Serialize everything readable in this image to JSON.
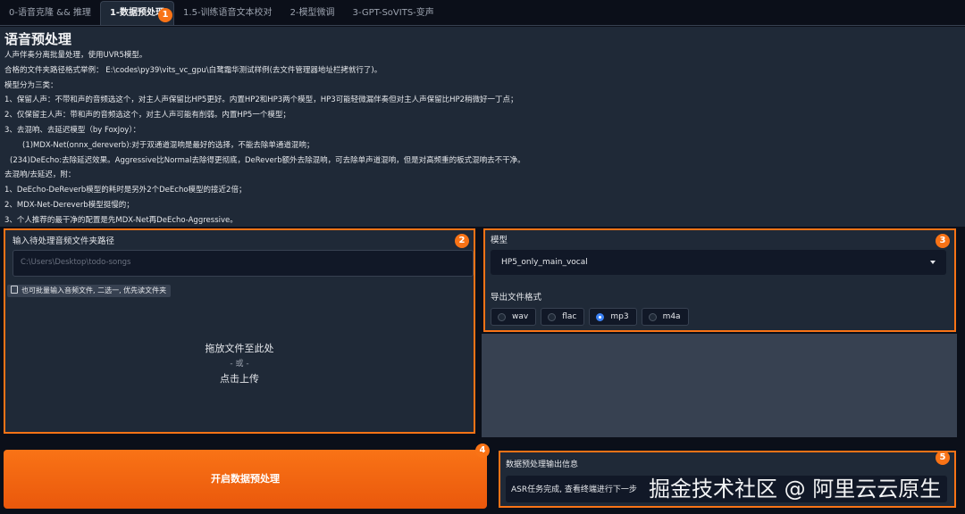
{
  "tabs": [
    {
      "label": "0-语音克隆 && 推理"
    },
    {
      "label": "1-数据预处理"
    },
    {
      "label": "1.5-训练语音文本校对"
    },
    {
      "label": "2-模型微调"
    },
    {
      "label": "3-GPT-SoVITS-变声"
    }
  ],
  "badges": [
    "1",
    "2",
    "3",
    "4",
    "5"
  ],
  "intro": {
    "title": "语音预处理",
    "lines": [
      "人声伴奏分离批量处理，使用UVR5模型。",
      "合格的文件夹路径格式举例： E:\\codes\\py39\\vits_vc_gpu\\白鹭霜华测试样例(去文件管理器地址栏拷就行了)。",
      "模型分为三类：",
      "1、保留人声：不带和声的音频选这个，对主人声保留比HP5更好。内置HP2和HP3两个模型，HP3可能轻微漏伴奏但对主人声保留比HP2稍微好一丁点；",
      "2、仅保留主人声：带和声的音频选这个，对主人声可能有削弱。内置HP5一个模型；",
      "3、去混响、去延迟模型（by FoxJoy）：",
      "(1)MDX-Net(onnx_dereverb):对于双通道混响是最好的选择，不能去除单通道混响；",
      "(234)DeEcho:去除延迟效果。Aggressive比Normal去除得更彻底，DeReverb额外去除混响，可去除单声道混响，但是对高频重的板式混响去不干净。",
      "去混响/去延迟，附：",
      "1、DeEcho-DeReverb模型的耗时是另外2个DeEcho模型的接近2倍；",
      "2、MDX-Net-Dereverb模型挺慢的；",
      "3、个人推荐的最干净的配置是先MDX-Net再DeEcho-Aggressive。"
    ]
  },
  "left_panel": {
    "label": "输入待处理音频文件夹路径",
    "placeholder": "C:\\Users\\Desktop\\todo-songs",
    "hint": "也可批量输入音频文件, 二选一, 优先读文件夹",
    "drop_text": "拖放文件至此处",
    "or_text": "- 或 -",
    "upload_text": "点击上传"
  },
  "right_panel": {
    "model_label": "模型",
    "model_value": "HP5_only_main_vocal",
    "format_label": "导出文件格式",
    "formats": [
      "wav",
      "flac",
      "mp3",
      "m4a"
    ],
    "selected_format": "mp3"
  },
  "start_button": "开启数据预处理",
  "output": {
    "label": "数据预处理输出信息",
    "value": "ASR任务完成, 查看终端进行下一步"
  },
  "watermark": "掘金技术社区 @ 阿里云云原生"
}
